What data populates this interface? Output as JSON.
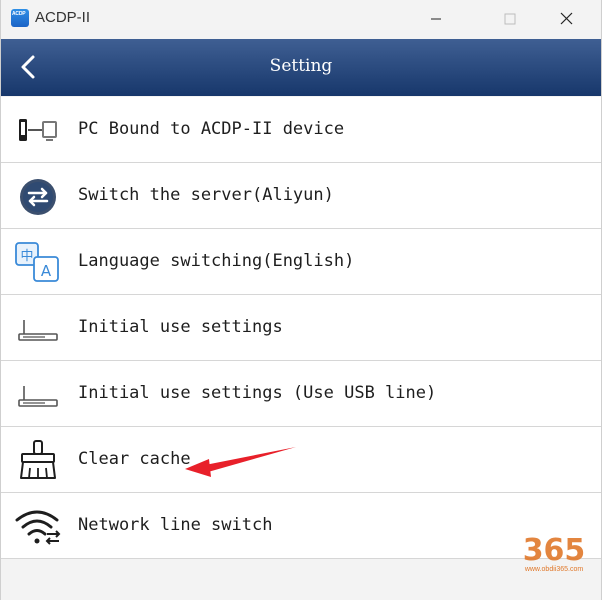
{
  "window": {
    "title": "ACDP-II",
    "app_icon_text": "ACDP"
  },
  "header": {
    "title": "Setting"
  },
  "menu": {
    "items": [
      {
        "label": "PC Bound to ACDP-II device",
        "icon": "phone-pc-link-icon"
      },
      {
        "label": "Switch the server(Aliyun)",
        "icon": "server-switch-icon"
      },
      {
        "label": "Language switching(English)",
        "icon": "language-translate-icon"
      },
      {
        "label": "Initial use settings",
        "icon": "router-icon"
      },
      {
        "label": "Initial use settings (Use USB line)",
        "icon": "router-usb-icon"
      },
      {
        "label": "Clear cache",
        "icon": "broom-icon"
      },
      {
        "label": "Network line switch",
        "icon": "wifi-switch-icon"
      }
    ]
  },
  "watermark": {
    "logo_text": "365",
    "url": "www.obdii365.com"
  },
  "colors": {
    "header_top": "#3f5f93",
    "header_bottom": "#17376b",
    "annotation_arrow": "#e8202a",
    "watermark": "#e0782a"
  }
}
